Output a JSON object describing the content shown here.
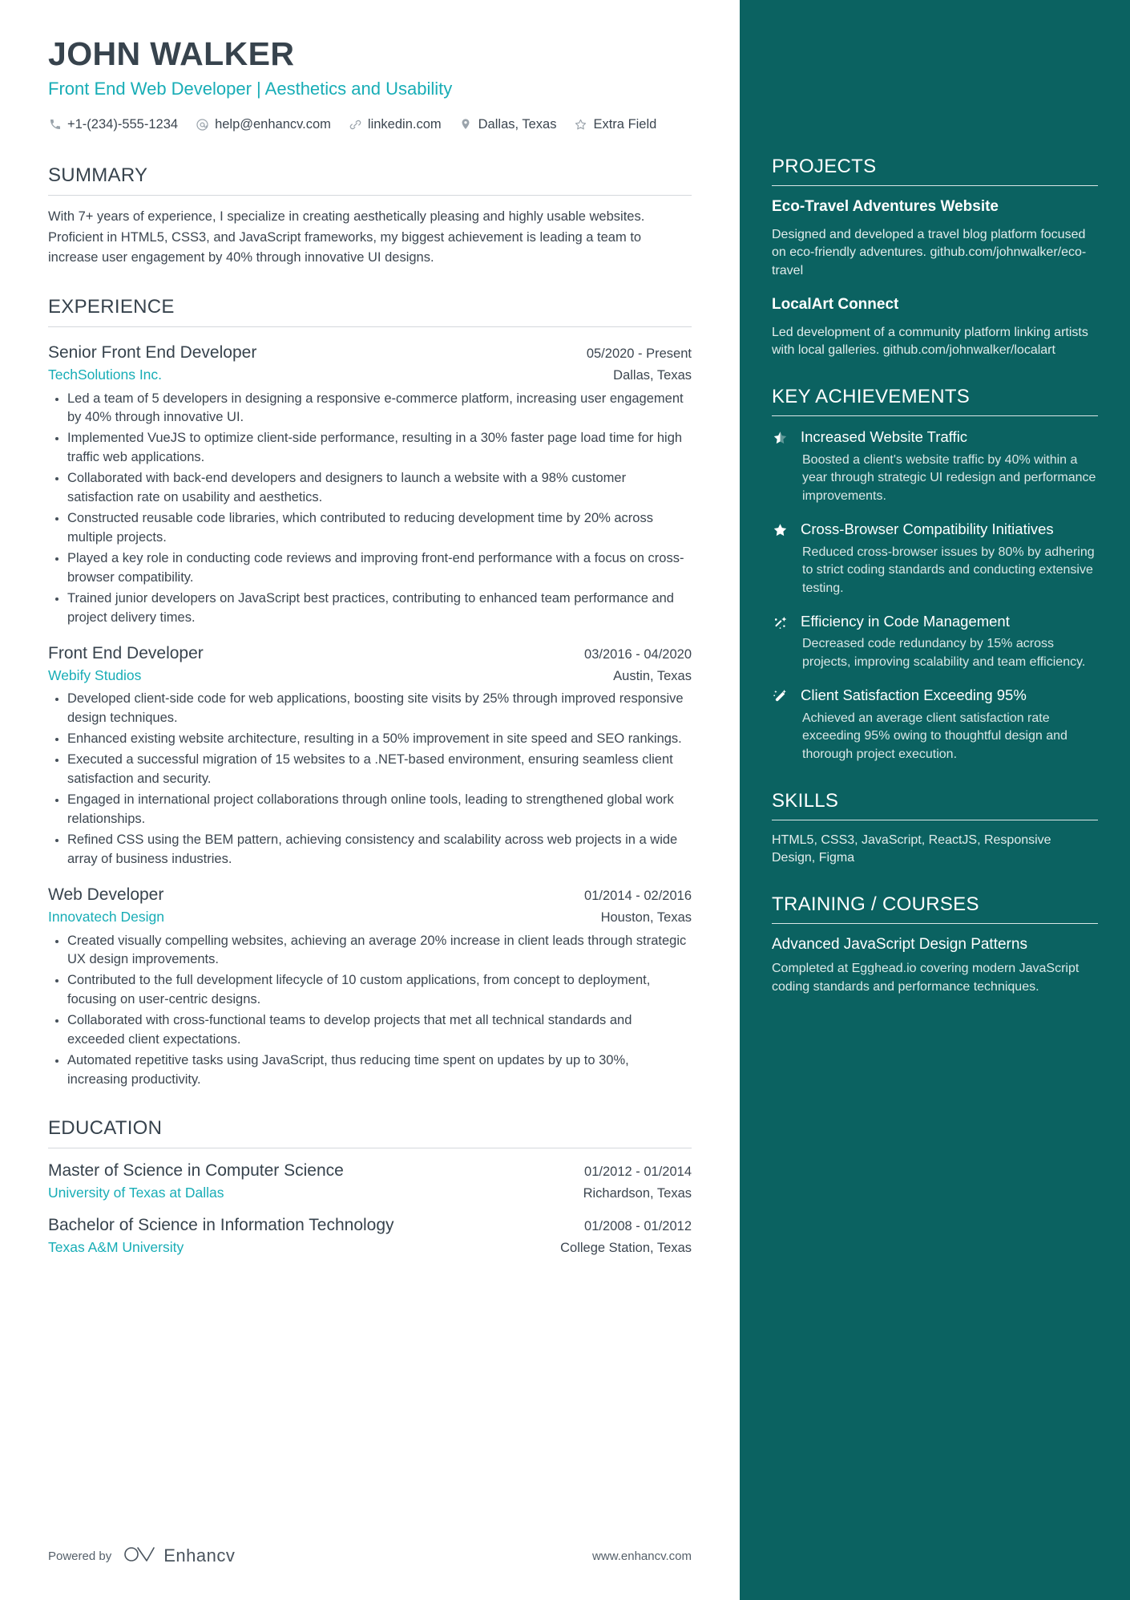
{
  "colors": {
    "accent": "#18adb6",
    "sidebar_bg": "#0b6261",
    "heading": "#37434d",
    "body": "#3c4650"
  },
  "header": {
    "name": "JOHN WALKER",
    "headline": "Front End Web Developer | Aesthetics and Usability",
    "contacts": [
      {
        "icon": "phone-icon",
        "text": "+1-(234)-555-1234"
      },
      {
        "icon": "email-icon",
        "text": "help@enhancv.com"
      },
      {
        "icon": "link-icon",
        "text": "linkedin.com"
      },
      {
        "icon": "location-pin-icon",
        "text": "Dallas, Texas"
      },
      {
        "icon": "star-outline-icon",
        "text": "Extra Field"
      }
    ]
  },
  "summary": {
    "title": "SUMMARY",
    "text": "With 7+ years of experience, I specialize in creating aesthetically pleasing and highly usable websites. Proficient in HTML5, CSS3, and JavaScript frameworks, my biggest achievement is leading a team to increase user engagement by 40% through innovative UI designs."
  },
  "experience": {
    "title": "EXPERIENCE",
    "entries": [
      {
        "role": "Senior Front End Developer",
        "dates": "05/2020 - Present",
        "company": "TechSolutions Inc.",
        "location": "Dallas, Texas",
        "bullets": [
          "Led a team of 5 developers in designing a responsive e-commerce platform, increasing user engagement by 40% through innovative UI.",
          "Implemented VueJS to optimize client-side performance, resulting in a 30% faster page load time for high traffic web applications.",
          "Collaborated with back-end developers and designers to launch a website with a 98% customer satisfaction rate on usability and aesthetics.",
          "Constructed reusable code libraries, which contributed to reducing development time by 20% across multiple projects.",
          "Played a key role in conducting code reviews and improving front-end performance with a focus on cross-browser compatibility.",
          "Trained junior developers on JavaScript best practices, contributing to enhanced team performance and project delivery times."
        ]
      },
      {
        "role": "Front End Developer",
        "dates": "03/2016 - 04/2020",
        "company": "Webify Studios",
        "location": "Austin, Texas",
        "bullets": [
          "Developed client-side code for web applications, boosting site visits by 25% through improved responsive design techniques.",
          "Enhanced existing website architecture, resulting in a 50% improvement in site speed and SEO rankings.",
          "Executed a successful migration of 15 websites to a .NET-based environment, ensuring seamless client satisfaction and security.",
          "Engaged in international project collaborations through online tools, leading to strengthened global work relationships.",
          "Refined CSS using the BEM pattern, achieving consistency and scalability across web projects in a wide array of business industries."
        ]
      },
      {
        "role": "Web Developer",
        "dates": "01/2014 - 02/2016",
        "company": "Innovatech Design",
        "location": "Houston, Texas",
        "bullets": [
          "Created visually compelling websites, achieving an average 20% increase in client leads through strategic UX design improvements.",
          "Contributed to the full development lifecycle of 10 custom applications, from concept to deployment, focusing on user-centric designs.",
          "Collaborated with cross-functional teams to develop projects that met all technical standards and exceeded client expectations.",
          "Automated repetitive tasks using JavaScript, thus reducing time spent on updates by up to 30%, increasing productivity."
        ]
      }
    ]
  },
  "education": {
    "title": "EDUCATION",
    "entries": [
      {
        "degree": "Master of Science in Computer Science",
        "dates": "01/2012 - 01/2014",
        "school": "University of Texas at Dallas",
        "location": "Richardson, Texas"
      },
      {
        "degree": "Bachelor of Science in Information Technology",
        "dates": "01/2008 - 01/2012",
        "school": "Texas A&M University",
        "location": "College Station, Texas"
      }
    ]
  },
  "footer": {
    "powered_by": "Powered by",
    "brand": "Enhancv",
    "website": "www.enhancv.com"
  },
  "sidebar": {
    "projects": {
      "title": "PROJECTS",
      "items": [
        {
          "name": "Eco-Travel Adventures Website",
          "description": "Designed and developed a travel blog platform focused on eco-friendly adventures. github.com/johnwalker/eco-travel"
        },
        {
          "name": "LocalArt Connect",
          "description": "Led development of a community platform linking artists with local galleries. github.com/johnwalker/localart"
        }
      ]
    },
    "achievements": {
      "title": "KEY ACHIEVEMENTS",
      "items": [
        {
          "icon": "half-star-icon",
          "title": "Increased Website Traffic",
          "description": "Boosted a client's website traffic by 40% within a year through strategic UI redesign and performance improvements."
        },
        {
          "icon": "star-filled-icon",
          "title": "Cross-Browser Compatibility Initiatives",
          "description": "Reduced cross-browser issues by 80% by adhering to strict coding standards and conducting extensive testing."
        },
        {
          "icon": "sparkle-icon",
          "title": "Efficiency in Code Management",
          "description": "Decreased code redundancy by 15% across projects, improving scalability and team efficiency."
        },
        {
          "icon": "magic-wand-icon",
          "title": "Client Satisfaction Exceeding 95%",
          "description": "Achieved an average client satisfaction rate exceeding 95% owing to thoughtful design and thorough project execution."
        }
      ]
    },
    "skills": {
      "title": "SKILLS",
      "text": "HTML5, CSS3, JavaScript, ReactJS, Responsive Design, Figma"
    },
    "training": {
      "title": "TRAINING / COURSES",
      "items": [
        {
          "name": "Advanced JavaScript Design Patterns",
          "description": "Completed at Egghead.io covering modern JavaScript coding standards and performance techniques."
        }
      ]
    }
  }
}
